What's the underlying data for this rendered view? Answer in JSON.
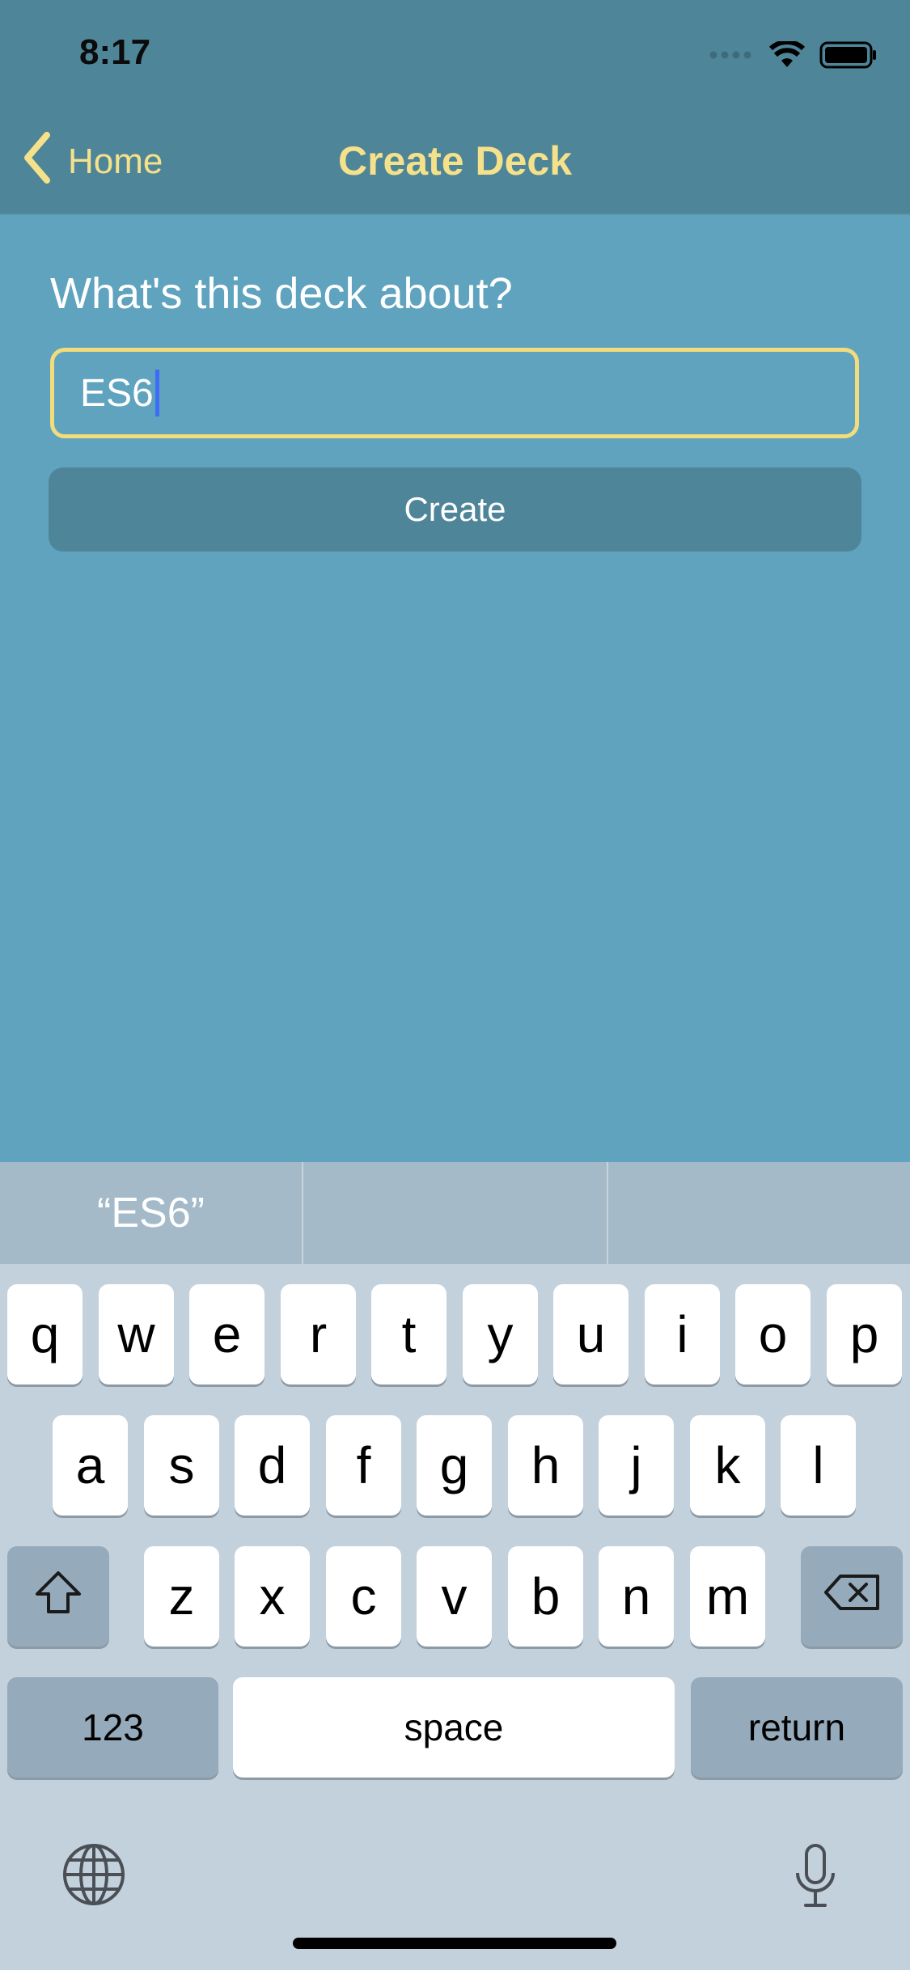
{
  "status": {
    "time": "8:17"
  },
  "nav": {
    "back_label": "Home",
    "title": "Create Deck"
  },
  "form": {
    "prompt": "What's this deck about?",
    "input_value": "ES6",
    "create_label": "Create"
  },
  "suggestions": [
    "“ES6”",
    "",
    ""
  ],
  "keyboard": {
    "row1": [
      "q",
      "w",
      "e",
      "r",
      "t",
      "y",
      "u",
      "i",
      "o",
      "p"
    ],
    "row2": [
      "a",
      "s",
      "d",
      "f",
      "g",
      "h",
      "j",
      "k",
      "l"
    ],
    "row3": [
      "z",
      "x",
      "c",
      "v",
      "b",
      "n",
      "m"
    ],
    "numbers_label": "123",
    "space_label": "space",
    "return_label": "return"
  },
  "colors": {
    "accent": "#f5e18a",
    "header": "#4f8599",
    "background": "#5fa3bf",
    "caret": "#3d6cf5"
  },
  "icons": [
    "chevron-left-icon",
    "signal-icon",
    "wifi-icon",
    "battery-icon",
    "shift-icon",
    "backspace-icon",
    "globe-icon",
    "microphone-icon"
  ]
}
